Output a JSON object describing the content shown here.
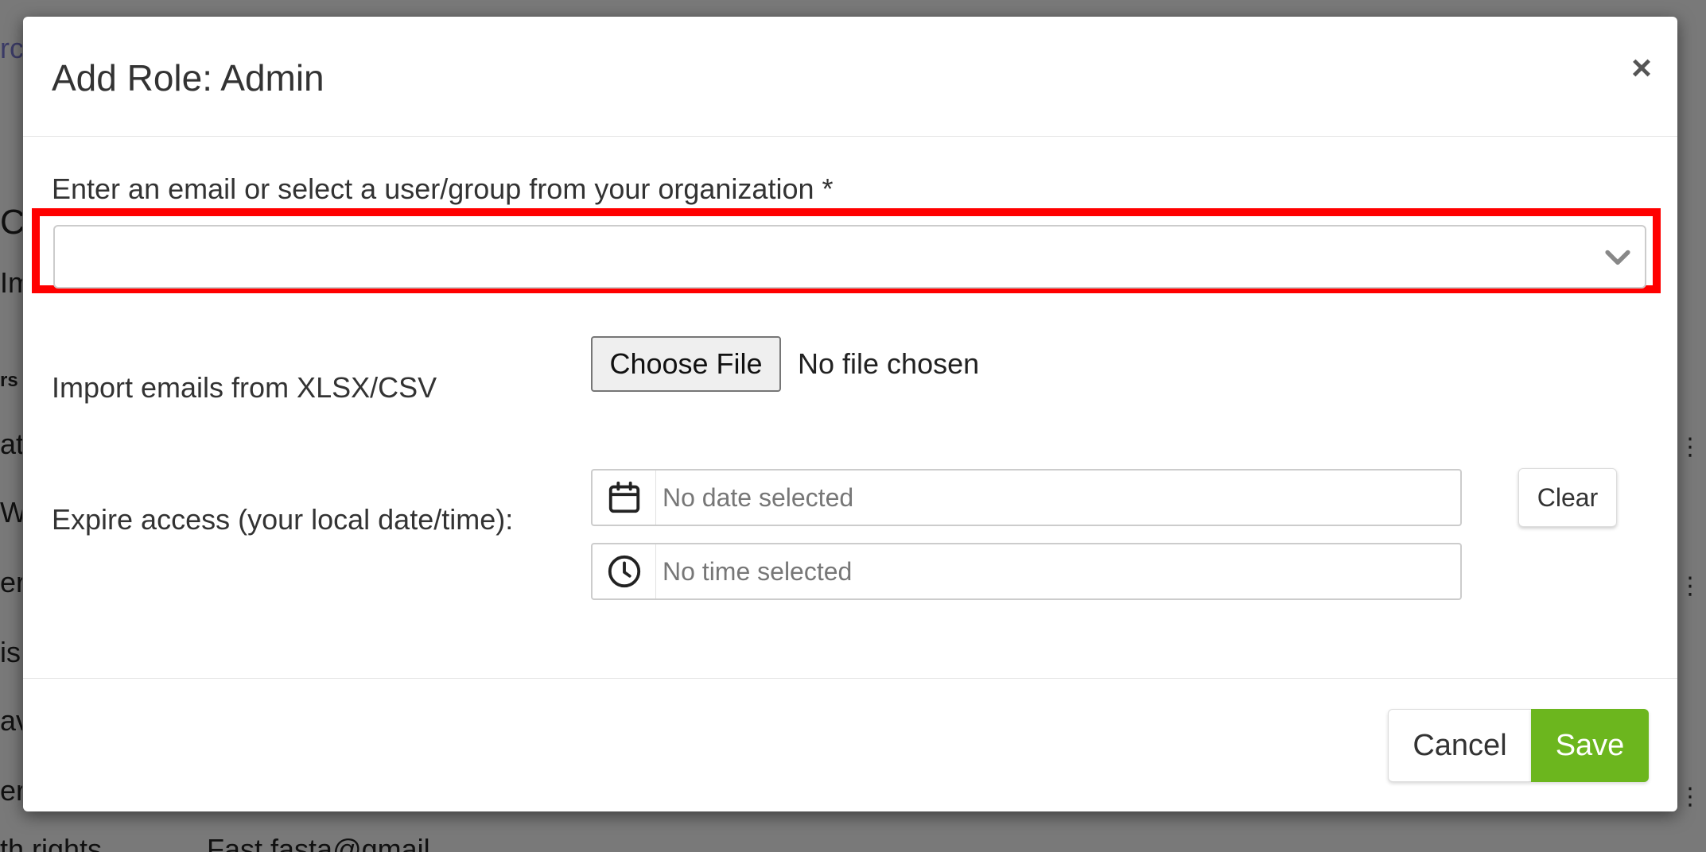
{
  "background": {
    "fragments": [
      "rc",
      "C",
      "Im",
      "rs",
      "at",
      "We",
      "er",
      "is",
      "av",
      "er"
    ],
    "bottom_left": "th rights",
    "bottom_mid": "Fast                          fasta@gmail"
  },
  "modal": {
    "title": "Add Role: Admin",
    "close_label": "×",
    "email_label": "Enter an email or select a user/group from your organization *",
    "email_value": "",
    "import_label": "Import emails from XLSX/CSV",
    "choose_file_label": "Choose File",
    "no_file_text": "No file chosen",
    "expire_label": "Expire access (your local date/time):",
    "date_placeholder": "No date selected",
    "time_placeholder": "No time selected",
    "clear_label": "Clear",
    "cancel_label": "Cancel",
    "save_label": "Save",
    "icons": {
      "select_arrow": "chevron-down-icon",
      "date": "calendar-icon",
      "time": "clock-icon"
    }
  },
  "colors": {
    "highlight": "#ff0000",
    "save_button": "#6cb61e"
  }
}
